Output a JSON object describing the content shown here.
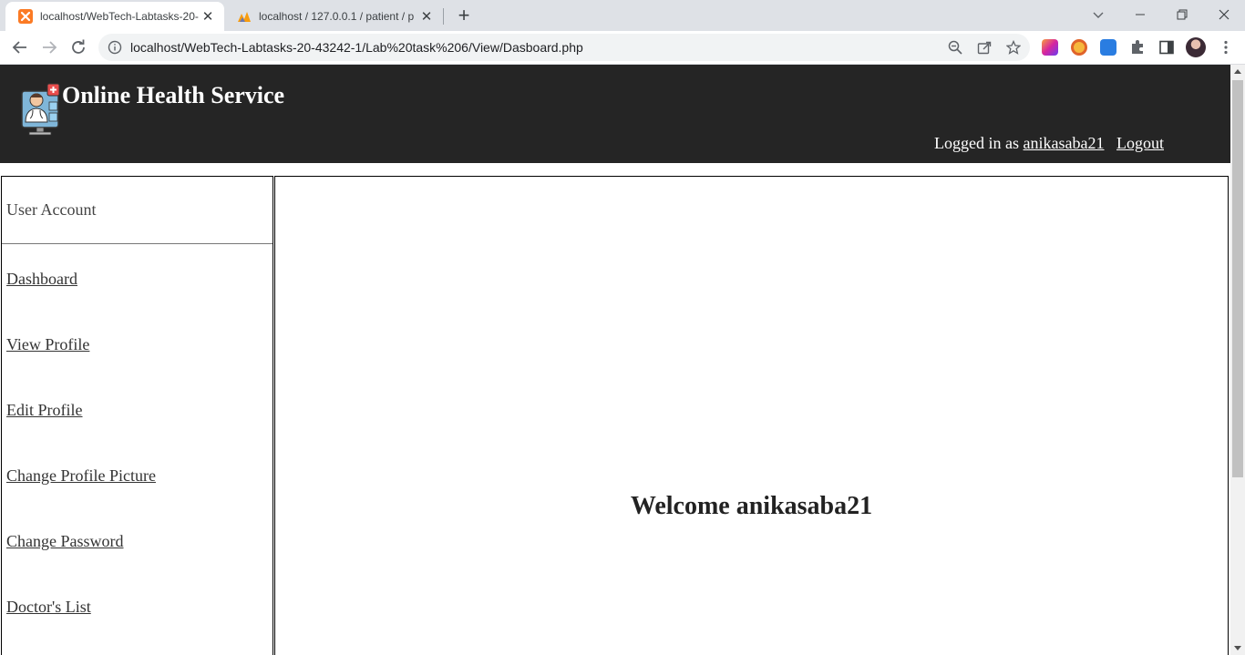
{
  "browser": {
    "tabs": [
      {
        "title": "localhost/WebTech-Labtasks-20-",
        "favicon": "xampp-icon",
        "active": true
      },
      {
        "title": "localhost / 127.0.0.1 / patient / p",
        "favicon": "phpmyadmin-icon",
        "active": false
      }
    ],
    "url": "localhost/WebTech-Labtasks-20-43242-1/Lab%20task%206/View/Dasboard.php"
  },
  "header": {
    "site_title": "Online Health Service",
    "logged_in_prefix": "Logged in as",
    "username": "anikasaba21",
    "logout_label": "Logout"
  },
  "sidebar": {
    "heading": "User Account",
    "items": [
      {
        "label": "Dashboard"
      },
      {
        "label": "View Profile"
      },
      {
        "label": "Edit Profile"
      },
      {
        "label": "Change Profile Picture"
      },
      {
        "label": "Change Password"
      },
      {
        "label": "Doctor's List"
      }
    ]
  },
  "main": {
    "welcome": "Welcome anikasaba21"
  },
  "colors": {
    "header_bg": "#252525",
    "tabstrip_bg": "#dee1e6",
    "page_bg": "#ffffff"
  }
}
